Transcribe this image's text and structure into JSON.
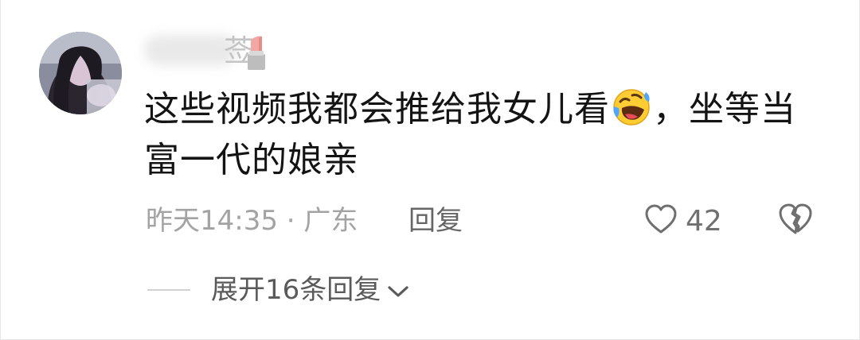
{
  "comment": {
    "author_visible_fragment": "莶",
    "author_emoji": "lipstick-icon",
    "text_line1_part1": "这些视频我都会推给我女儿看",
    "text_emoji": "rolling-on-floor-laughing-emoji",
    "text_line1_part2": "，坐等当",
    "text_line2": "富一代的娘亲",
    "time": "昨天14:35",
    "separator": "·",
    "location": "广东",
    "reply_label": "回复",
    "like_count": "42"
  },
  "replies": {
    "expand_label": "展开16条回复"
  },
  "colors": {
    "text_primary": "#141414",
    "text_meta": "#a3a3a3",
    "text_secondary": "#5a5a5a"
  }
}
